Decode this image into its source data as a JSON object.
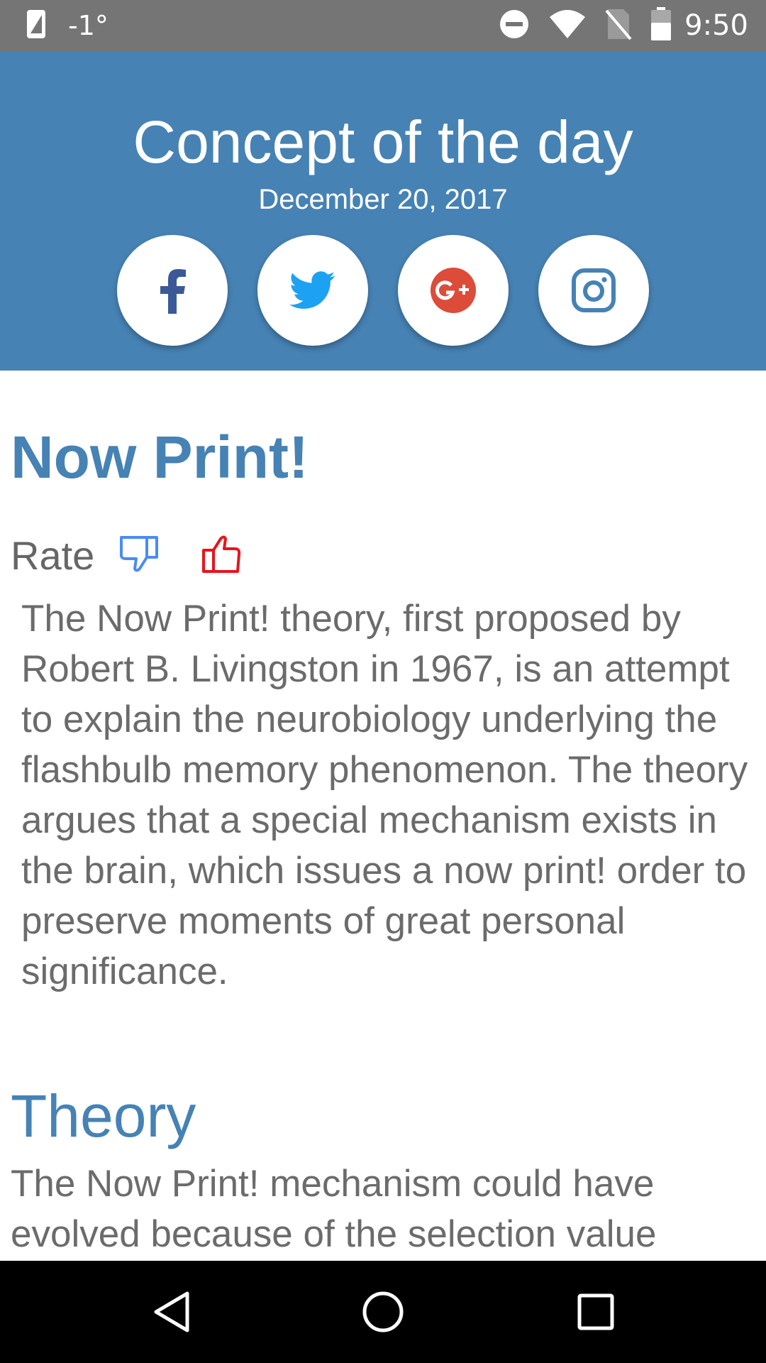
{
  "status_bar": {
    "temperature": "-1°",
    "time": "9:50"
  },
  "header": {
    "title": "Concept of the day",
    "date": "December 20, 2017",
    "social": [
      {
        "name": "facebook",
        "icon": "facebook-icon",
        "color": "#3b5998"
      },
      {
        "name": "twitter",
        "icon": "twitter-icon",
        "color": "#1da1f2"
      },
      {
        "name": "google-plus",
        "icon": "google-plus-icon",
        "color": "#dd4b39"
      },
      {
        "name": "instagram",
        "icon": "instagram-icon",
        "color": "#4682b4"
      }
    ]
  },
  "content": {
    "title": "Now Print!",
    "rate_label": "Rate",
    "intro": "The Now Print! theory, first proposed by Robert B. Livingston in 1967, is an attempt to explain the neurobiology underlying the flashbulb memory phenomenon. The theory argues that a special mechanism exists in the brain, which issues a now print! order to preserve moments of great personal significance.",
    "section_title": "Theory",
    "section_text": "The Now Print! mechanism could have evolved because of the selection value"
  },
  "colors": {
    "accent": "#4682b4",
    "thumb_down": "#4a8cf0",
    "thumb_up": "#e8141c",
    "body_text": "#6b6b6b"
  }
}
